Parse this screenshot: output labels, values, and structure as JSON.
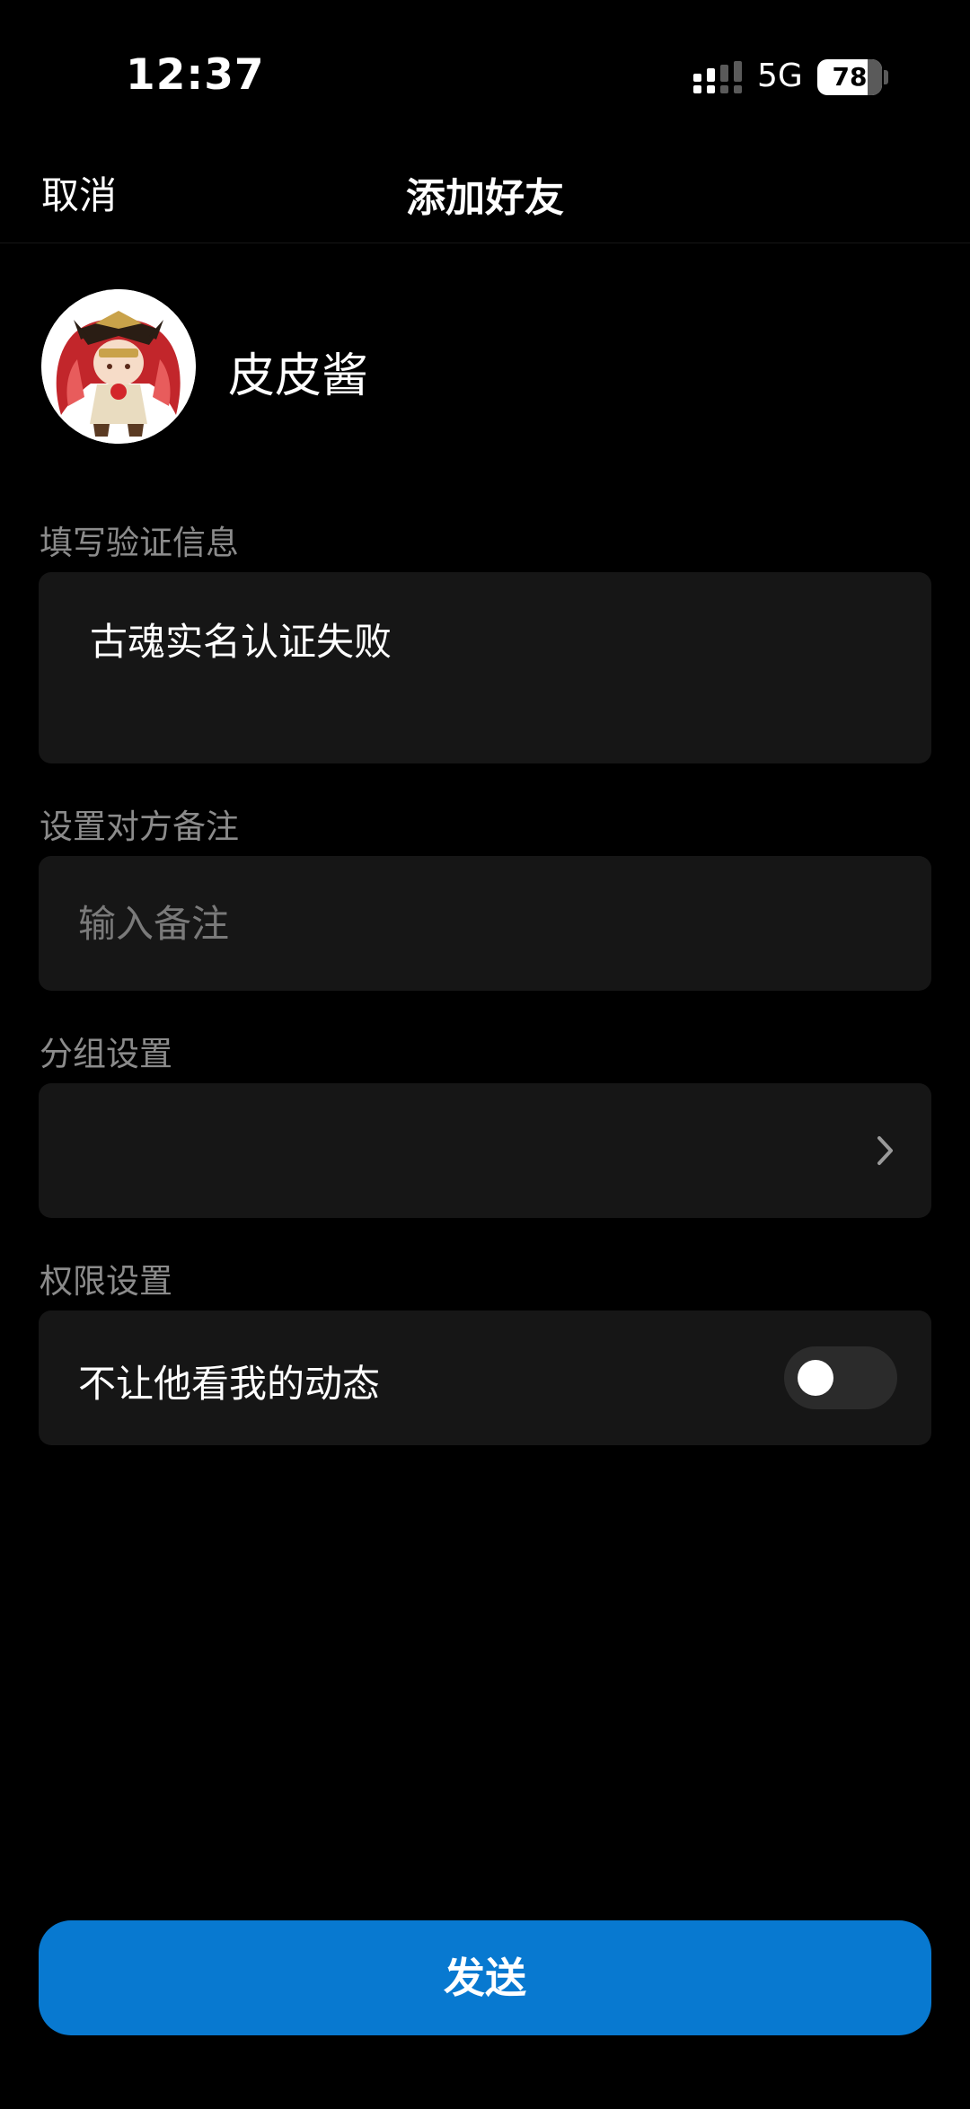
{
  "status_bar": {
    "time": "12:37",
    "network": "5G",
    "battery_level": "78",
    "battery_fraction": 0.78,
    "signal_icon": "signal-bars-icon"
  },
  "nav": {
    "cancel_label": "取消",
    "title": "添加好友"
  },
  "profile": {
    "name": "皮皮酱",
    "avatar_icon": "anime-avatar"
  },
  "verification": {
    "section_label": "填写验证信息",
    "message": "古魂实名认证失败"
  },
  "remark": {
    "section_label": "设置对方备注",
    "placeholder": "输入备注",
    "value": ""
  },
  "group": {
    "section_label": "分组设置",
    "value": "",
    "chevron_icon": "chevron-right-icon"
  },
  "permissions": {
    "section_label": "权限设置",
    "hide_moments_label": "不让他看我的动态",
    "hide_moments_enabled": false
  },
  "send_button_label": "发送",
  "colors": {
    "background": "#000000",
    "card": "#161616",
    "accent": "#0879d0",
    "label_gray": "#8b8b8b",
    "placeholder_gray": "#7a7a7a"
  }
}
